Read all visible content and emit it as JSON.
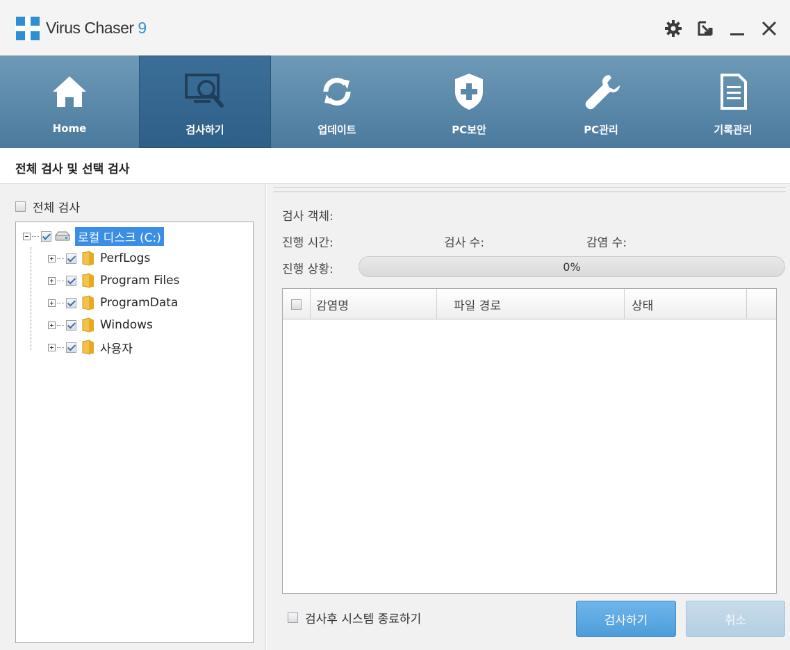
{
  "app": {
    "title": "Virus Chaser",
    "version": "9"
  },
  "nav": {
    "items": [
      {
        "label": "Home",
        "icon": "home-icon"
      },
      {
        "label": "검사하기",
        "icon": "scan-monitor-icon",
        "active": true
      },
      {
        "label": "업데이트",
        "icon": "refresh-icon"
      },
      {
        "label": "PC보안",
        "icon": "shield-plus-icon"
      },
      {
        "label": "PC관리",
        "icon": "wrench-icon"
      },
      {
        "label": "기록관리",
        "icon": "document-icon"
      }
    ]
  },
  "section": {
    "title": "전체 검사 및 선택 검사"
  },
  "left": {
    "full_scan_label": "전체 검사",
    "full_scan_checked": false,
    "tree": {
      "root_label": "로컬 디스크 (C:)",
      "children": [
        "PerfLogs",
        "Program Files",
        "ProgramData",
        "Windows",
        "사용자"
      ]
    }
  },
  "right": {
    "scan_object_label": "검사 객체:",
    "elapsed_label": "진행 시간:",
    "scanned_count_label": "검사 수:",
    "infected_count_label": "감염 수:",
    "progress_label": "진행 상황:",
    "progress_text": "0%",
    "progress_value": 0,
    "columns": [
      "감염명",
      "파일 경로",
      "상태"
    ],
    "shutdown_label": "검사후 시스템 종료하기",
    "scan_button": "검사하기",
    "cancel_button": "취소"
  },
  "colors": {
    "accent": "#2f8fd2",
    "nav_bg": "#5a88aa",
    "nav_active": "#356892",
    "selection": "#3a8ee6"
  }
}
